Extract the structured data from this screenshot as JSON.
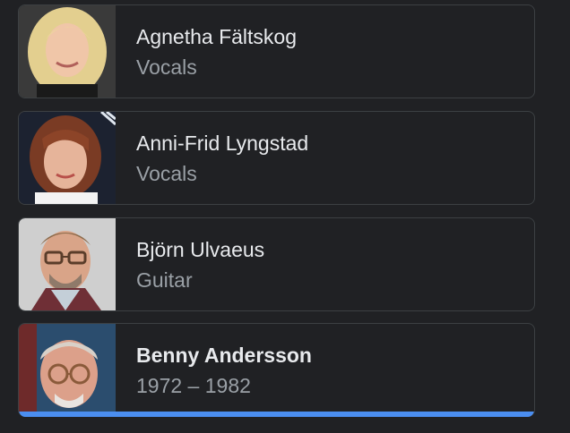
{
  "members": [
    {
      "name": "Agnetha Fältskog",
      "subtitle": "Vocals",
      "photo": "agnetha-photo"
    },
    {
      "name": "Anni-Frid Lyngstad",
      "subtitle": "Vocals",
      "photo": "anni-frid-photo"
    },
    {
      "name": "Björn Ulvaeus",
      "subtitle": "Guitar",
      "photo": "bjorn-photo"
    },
    {
      "name": "Benny Andersson",
      "subtitle": "1972 – 1982",
      "photo": "benny-photo",
      "selected": true
    }
  ],
  "colors": {
    "background": "#202124",
    "card_border": "#3c4043",
    "name_text": "#e8eaed",
    "subtitle_text": "#9aa0a6",
    "selected_accent": "#4b8ef0"
  }
}
